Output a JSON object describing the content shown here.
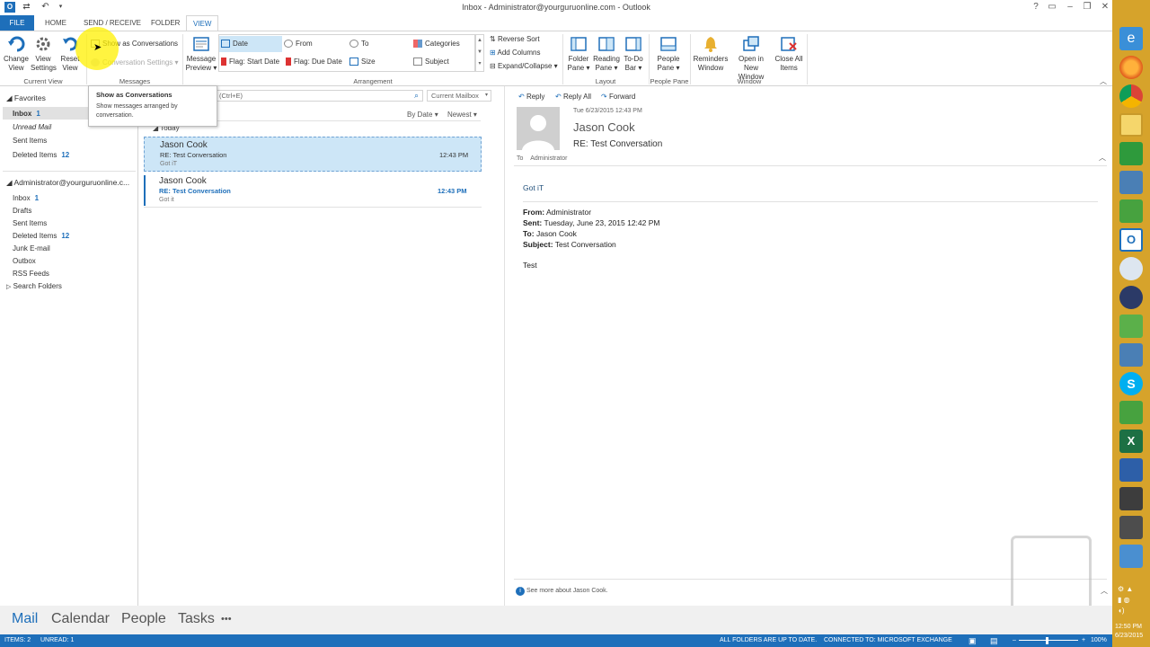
{
  "window": {
    "title": "Inbox - Administrator@yourguruonline.com - Outlook"
  },
  "tabs": [
    "FILE",
    "HOME",
    "SEND / RECEIVE",
    "FOLDER",
    "VIEW"
  ],
  "ribbon": {
    "change_view": "Change View",
    "view_settings": "View Settings",
    "reset_view": "Reset View",
    "show_as_conversations": "Show as Conversations",
    "conversation_settings": "Conversation Settings",
    "message_preview": "Message Preview",
    "arr": {
      "date": "Date",
      "from": "From",
      "to": "To",
      "categories": "Categories",
      "flag_start": "Flag: Start Date",
      "flag_due": "Flag: Due Date",
      "size": "Size",
      "subject": "Subject"
    },
    "reverse_sort": "Reverse Sort",
    "add_columns": "Add Columns",
    "expand_collapse": "Expand/Collapse",
    "folder_pane": "Folder Pane",
    "reading_pane": "Reading Pane",
    "todo_bar": "To-Do Bar",
    "people_pane": "People Pane",
    "reminders": "Reminders Window",
    "open_new": "Open in New Window",
    "close_all": "Close All Items",
    "groups": {
      "current_view": "Current View",
      "messages": "Messages",
      "arrangement": "Arrangement",
      "layout": "Layout",
      "people_pane": "People Pane",
      "window": "Window"
    }
  },
  "tooltip": {
    "title": "Show as Conversations",
    "body1": "Show messages arranged by",
    "body2": "conversation."
  },
  "nav": {
    "favorites": "Favorites",
    "fav_items": [
      {
        "label": "Inbox",
        "count": "1"
      },
      {
        "label": "Unread Mail",
        "count": ""
      },
      {
        "label": "Sent Items",
        "count": ""
      },
      {
        "label": "Deleted Items",
        "count": "12"
      }
    ],
    "account": "Administrator@yourguruonline.c...",
    "acc_items": [
      {
        "label": "Inbox",
        "count": "1"
      },
      {
        "label": "Drafts",
        "count": ""
      },
      {
        "label": "Sent Items",
        "count": ""
      },
      {
        "label": "Deleted Items",
        "count": "12"
      },
      {
        "label": "Junk E-mail",
        "count": ""
      },
      {
        "label": "Outbox",
        "count": ""
      },
      {
        "label": "RSS Feeds",
        "count": ""
      },
      {
        "label": "Search Folders",
        "count": ""
      }
    ]
  },
  "list": {
    "search_placeholder": "ox (Ctrl+E)",
    "scope": "Current Mailbox",
    "sort_by": "By Date",
    "sort_order": "Newest",
    "group": "Today",
    "items": [
      {
        "sender": "Jason Cook",
        "subject": "RE: Test Conversation",
        "preview": "Got iT",
        "time": "12:43 PM"
      },
      {
        "sender": "Jason Cook",
        "subject": "RE: Test Conversation",
        "preview": "Got it",
        "time": "12:43 PM"
      }
    ]
  },
  "reading": {
    "reply": "Reply",
    "reply_all": "Reply All",
    "forward": "Forward",
    "date": "Tue 6/23/2015 12:43 PM",
    "sender": "Jason Cook",
    "subject": "RE: Test Conversation",
    "to_label": "To",
    "to": "Administrator",
    "body_line": "Got iT",
    "from_label": "From:",
    "from_val": "Administrator",
    "sent_label": "Sent:",
    "sent_val": "Tuesday, June 23, 2015 12:42 PM",
    "to2_label": "To:",
    "to2_val": "Jason Cook",
    "subj_label": "Subject:",
    "subj_val": "Test Conversation",
    "orig_body": "Test",
    "people_info": "See more about Jason Cook."
  },
  "bottom_nav": [
    "Mail",
    "Calendar",
    "People",
    "Tasks",
    "•••"
  ],
  "status": {
    "items": "ITEMS: 2",
    "unread": "UNREAD: 1",
    "sync": "ALL FOLDERS ARE UP TO DATE.",
    "conn": "CONNECTED TO: MICROSOFT EXCHANGE",
    "zoom": "100%"
  },
  "taskbar": {
    "time": "12:50 PM",
    "date": "6/23/2015"
  },
  "colors": {
    "accent": "#1e6fba",
    "taskbar": "#d6a32b",
    "selected": "#cde6f7"
  }
}
